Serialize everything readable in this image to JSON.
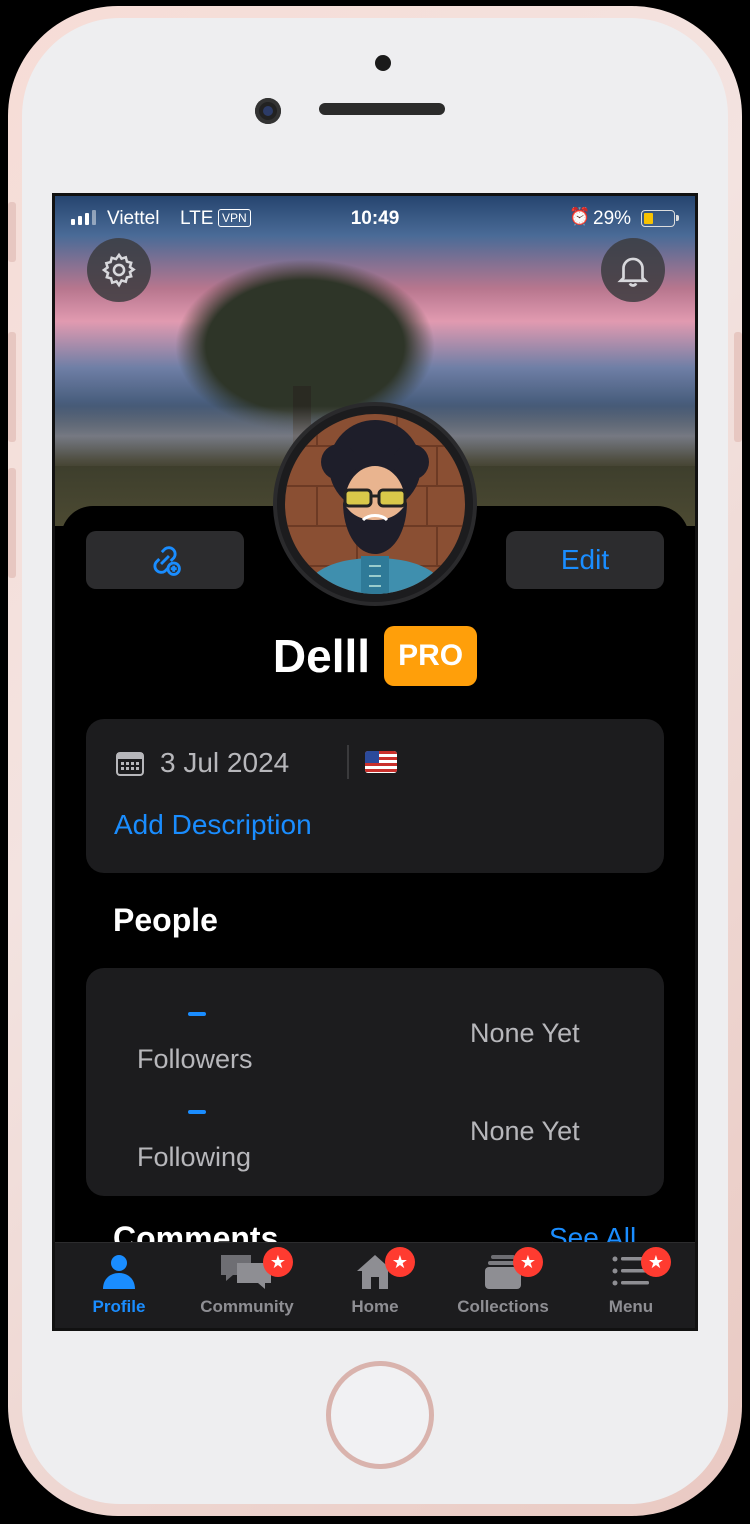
{
  "status_bar": {
    "carrier": "Viettel",
    "network": "LTE",
    "vpn": "VPN",
    "time": "10:49",
    "battery": "29%"
  },
  "profile": {
    "name": "Delll",
    "badge": "PRO",
    "edit_label": "Edit",
    "join_date": "3 Jul 2024",
    "add_description": "Add Description"
  },
  "people": {
    "title": "People",
    "followers_label": "Followers",
    "followers_value": "None Yet",
    "following_label": "Following",
    "following_value": "None Yet"
  },
  "comments": {
    "title": "Comments",
    "see_all": "See All"
  },
  "tabs": [
    {
      "label": "Profile",
      "icon": "person-icon",
      "active": true
    },
    {
      "label": "Community",
      "icon": "chat-bubbles-icon",
      "badge": true
    },
    {
      "label": "Home",
      "icon": "home-icon",
      "badge": true
    },
    {
      "label": "Collections",
      "icon": "collections-icon",
      "badge": true
    },
    {
      "label": "Menu",
      "icon": "list-icon",
      "badge": true
    }
  ],
  "colors": {
    "accent": "#1a8dff",
    "pro_badge": "#ff9f0a",
    "card": "#1c1c1e",
    "notification_badge": "#ff3b30"
  }
}
